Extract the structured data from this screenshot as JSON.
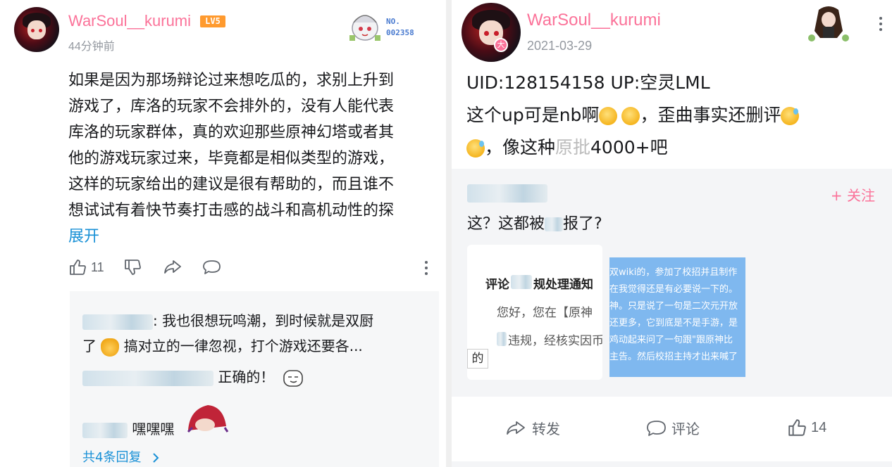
{
  "left": {
    "username": "WarSoul__kurumi",
    "level_badge": "LV5",
    "time": "44分钟前",
    "fan_badge": {
      "label": "NO.",
      "number": "002358"
    },
    "comment_lines": [
      "如果是因为那场辩论过来想吃瓜的，求别上升到",
      "游戏了，库洛的玩家不会排外的，没有人能代表",
      "库洛的玩家群体，真的欢迎那些原神幻塔或者其",
      "他的游戏玩家过来，毕竟都是相似类型的游戏，",
      "这样的玩家给出的建议是很有帮助的，而且谁不",
      "想试试有着快节奏打击感的战斗和高机动性的探"
    ],
    "expand_label": "展开",
    "like_count": "11",
    "replies": [
      {
        "text_a": ": 我也很想玩鸣潮，到时候就是双厨",
        "text_b": "了",
        "text_c": "搞对立的一律忽视，打个游戏还要各..."
      },
      {
        "text": "正确的！"
      },
      {
        "text": "嘿嘿嘿"
      }
    ],
    "more_replies": "共4条回复"
  },
  "right": {
    "username": "WarSoul__kurumi",
    "date": "2021-03-29",
    "avatar_badge": "大",
    "post_lines": {
      "line1": "UID:128154158 UP:空灵LML",
      "line2_a": "这个up可是nb啊",
      "line2_b": "，歪曲事实还删评",
      "line3_a": "，像这种",
      "line3_b": "原批",
      "line3_c": "4000+吧"
    },
    "repost": {
      "follow_label": "+ 关注",
      "text_a": "这？这都被",
      "text_b": "报了?",
      "card_left_lines": [
        "评论",
        "规处理通知",
        "您好，您在【原神",
        "违规，经核实因币",
        "的"
      ],
      "card_right_lines": [
        "双wiki的，参加了校招并且制作",
        "在我觉得还是有必要说一下的。",
        "神。只是说了一句是二次元开放",
        "还更多，它到底是不是手游，是",
        "鸡动起来问了一句跟\"跟原神比",
        "主告。然后校招主持才出来喊了"
      ]
    },
    "footer": {
      "repost_label": "转发",
      "comment_label": "评论",
      "like_count": "14"
    }
  },
  "colors": {
    "username_pink": "#fb7299",
    "link_blue": "#1890d6",
    "level_orange": "#ff9a2e",
    "gray_text": "#9499a0",
    "card_blue": "#7fb8ef"
  }
}
